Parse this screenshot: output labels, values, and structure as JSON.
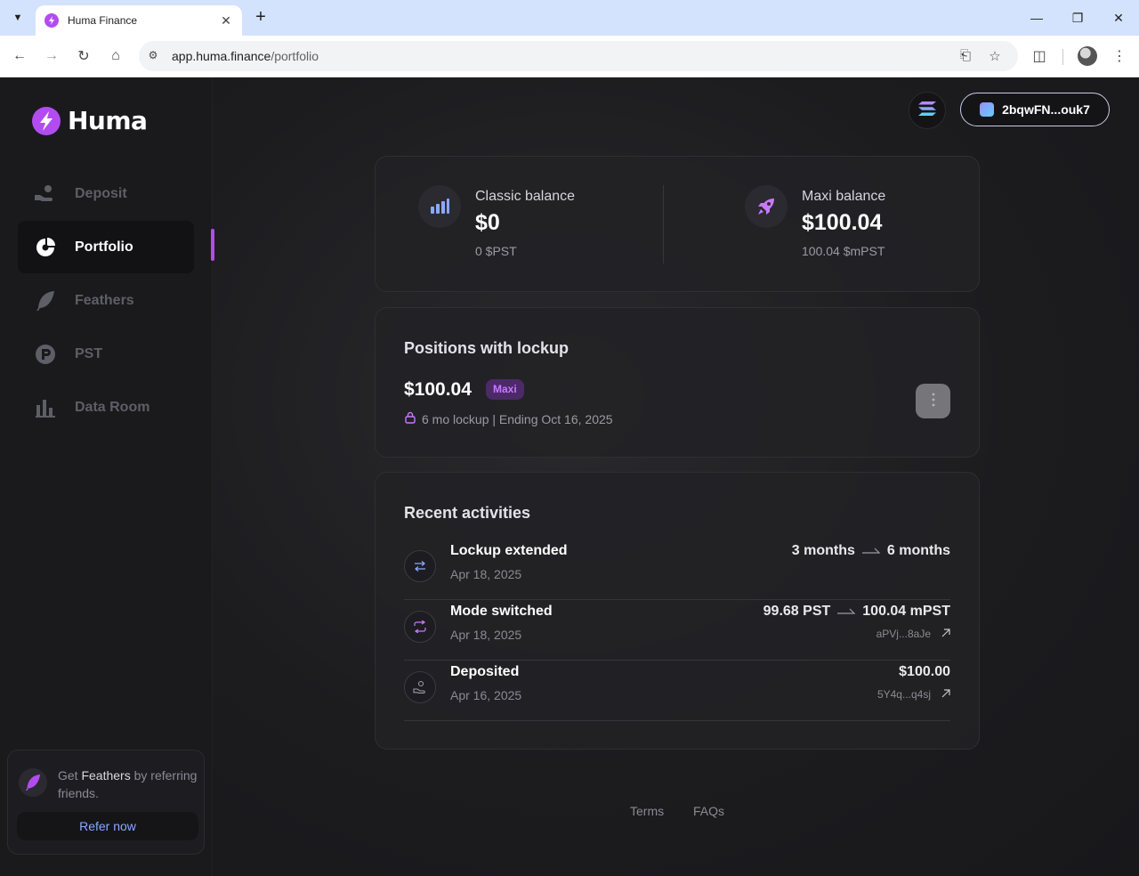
{
  "browser": {
    "tab_title": "Huma Finance",
    "url_host": "app.huma.finance",
    "url_path": "/portfolio"
  },
  "brand": {
    "name": "Huma",
    "accent": "#b24cf0"
  },
  "sidebar": {
    "items": [
      {
        "label": "Deposit",
        "icon": "deposit-icon",
        "active": false
      },
      {
        "label": "Portfolio",
        "icon": "portfolio-icon",
        "active": true
      },
      {
        "label": "Feathers",
        "icon": "feather-icon",
        "active": false
      },
      {
        "label": "PST",
        "icon": "pst-icon",
        "active": false
      },
      {
        "label": "Data Room",
        "icon": "bar-chart-icon",
        "active": false
      }
    ],
    "referral": {
      "text_prefix": "Get",
      "text_highlight": "Feathers",
      "text_suffix": "by referring friends.",
      "button_label": "Refer now"
    }
  },
  "header": {
    "network_icon": "solana-icon",
    "wallet_label": "2bqwFN...ouk7"
  },
  "balances": {
    "classic": {
      "title": "Classic balance",
      "value": "$0",
      "sub": "0 $PST"
    },
    "maxi": {
      "title": "Maxi balance",
      "value": "$100.04",
      "sub": "100.04 $mPST"
    }
  },
  "positions": {
    "title": "Positions with lockup",
    "amount": "$100.04",
    "badge": "Maxi",
    "detail": "6 mo lockup | Ending Oct 16, 2025"
  },
  "activities": {
    "title": "Recent activities",
    "items": [
      {
        "title": "Lockup extended",
        "date": "Apr 18, 2025",
        "from": "3 months",
        "to": "6 months",
        "amount": "",
        "tx": "",
        "icon": "transfer-icon"
      },
      {
        "title": "Mode switched",
        "date": "Apr 18, 2025",
        "from": "99.68 PST",
        "to": "100.04 mPST",
        "amount": "",
        "tx": "aPVj...8aJe",
        "icon": "swap-icon"
      },
      {
        "title": "Deposited",
        "date": "Apr 16, 2025",
        "from": "",
        "to": "",
        "amount": "$100.00",
        "tx": "5Y4q...q4sj",
        "icon": "deposit-icon"
      }
    ]
  },
  "footer": {
    "terms": "Terms",
    "faqs": "FAQs"
  }
}
